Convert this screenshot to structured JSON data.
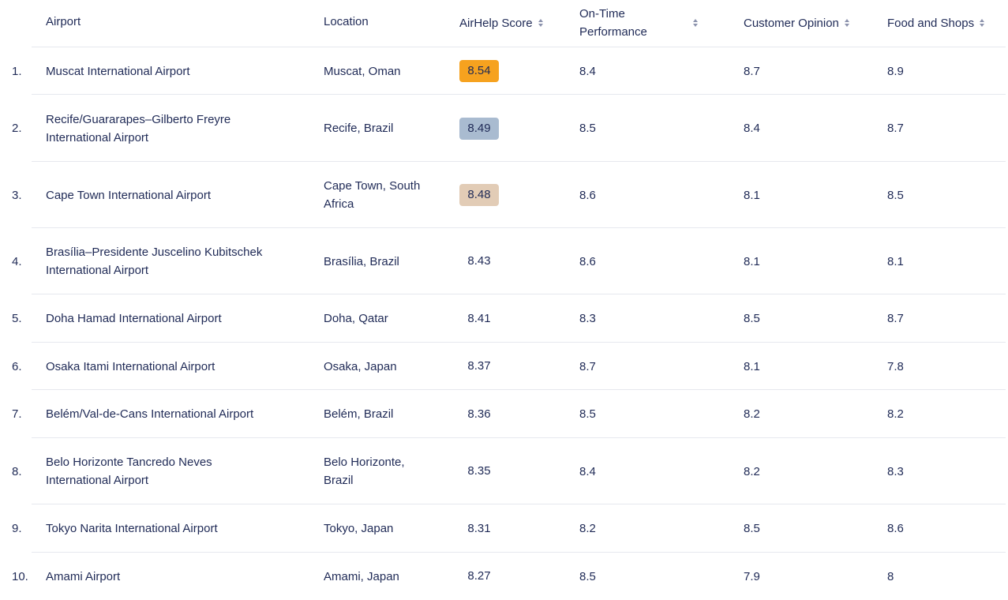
{
  "headers": {
    "airport": "Airport",
    "location": "Location",
    "score": "AirHelp Score",
    "ontime": "On-Time Performance",
    "opinion": "Customer Opinion",
    "food": "Food and Shops"
  },
  "colors": {
    "gold": "#f6a21f",
    "silver": "#a9bbd0",
    "bronze": "#e2ccb6",
    "text": "#1f2a56"
  },
  "rows": [
    {
      "rank": "1.",
      "airport": "Muscat International Airport",
      "location": "Muscat, Oman",
      "score": "8.54",
      "ontime": "8.4",
      "opinion": "8.7",
      "food": "8.9"
    },
    {
      "rank": "2.",
      "airport": "Recife/Guararapes–Gilberto Freyre International Airport",
      "location": "Recife, Brazil",
      "score": "8.49",
      "ontime": "8.5",
      "opinion": "8.4",
      "food": "8.7"
    },
    {
      "rank": "3.",
      "airport": "Cape Town International Airport",
      "location": "Cape Town, South Africa",
      "score": "8.48",
      "ontime": "8.6",
      "opinion": "8.1",
      "food": "8.5"
    },
    {
      "rank": "4.",
      "airport": "Brasília–Presidente Juscelino Kubitschek International Airport",
      "location": "Brasília, Brazil",
      "score": "8.43",
      "ontime": "8.6",
      "opinion": "8.1",
      "food": "8.1"
    },
    {
      "rank": "5.",
      "airport": "Doha Hamad International Airport",
      "location": "Doha, Qatar",
      "score": "8.41",
      "ontime": "8.3",
      "opinion": "8.5",
      "food": "8.7"
    },
    {
      "rank": "6.",
      "airport": "Osaka Itami International Airport",
      "location": "Osaka, Japan",
      "score": "8.37",
      "ontime": "8.7",
      "opinion": "8.1",
      "food": "7.8"
    },
    {
      "rank": "7.",
      "airport": "Belém/Val-de-Cans International Airport",
      "location": "Belém, Brazil",
      "score": "8.36",
      "ontime": "8.5",
      "opinion": "8.2",
      "food": "8.2"
    },
    {
      "rank": "8.",
      "airport": "Belo Horizonte Tancredo Neves International Airport",
      "location": "Belo Horizonte, Brazil",
      "score": "8.35",
      "ontime": "8.4",
      "opinion": "8.2",
      "food": "8.3"
    },
    {
      "rank": "9.",
      "airport": "Tokyo Narita International Airport",
      "location": "Tokyo, Japan",
      "score": "8.31",
      "ontime": "8.2",
      "opinion": "8.5",
      "food": "8.6"
    },
    {
      "rank": "10.",
      "airport": "Amami Airport",
      "location": "Amami, Japan",
      "score": "8.27",
      "ontime": "8.5",
      "opinion": "7.9",
      "food": "8"
    }
  ]
}
